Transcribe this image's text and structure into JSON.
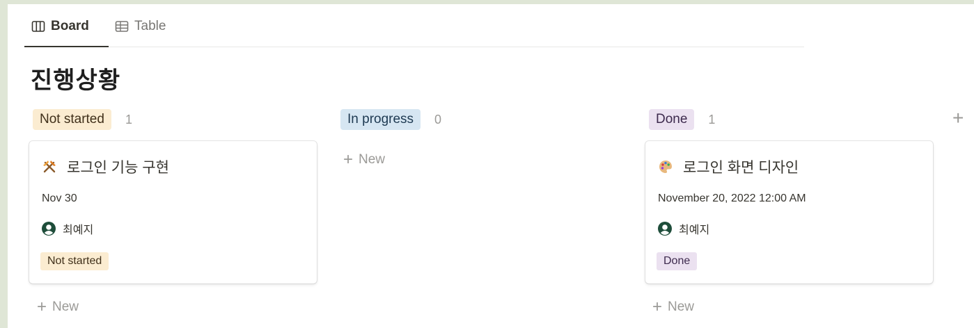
{
  "tabs": [
    {
      "label": "Board",
      "active": true,
      "icon": "board-icon"
    },
    {
      "label": "Table",
      "active": false,
      "icon": "table-icon"
    }
  ],
  "title": "진행상황",
  "columns": [
    {
      "status": "Not started",
      "count": "1",
      "color": "#fbecd1",
      "cards": [
        {
          "icon": "hammer-and-pick-icon",
          "title": "로그인 기능 구현",
          "date": "Nov 30",
          "person": "최예지",
          "tag": "Not started"
        }
      ],
      "new_label": "New"
    },
    {
      "status": "In progress",
      "count": "0",
      "color": "#d6e6f2",
      "cards": [],
      "new_label": "New"
    },
    {
      "status": "Done",
      "count": "1",
      "color": "#ebe1f0",
      "cards": [
        {
          "icon": "palette-icon",
          "title": "로그인 화면 디자인",
          "date": "November 20, 2022 12:00 AM",
          "person": "최예지",
          "tag": "Done"
        }
      ],
      "new_label": "New"
    }
  ],
  "add_group_label": "+"
}
